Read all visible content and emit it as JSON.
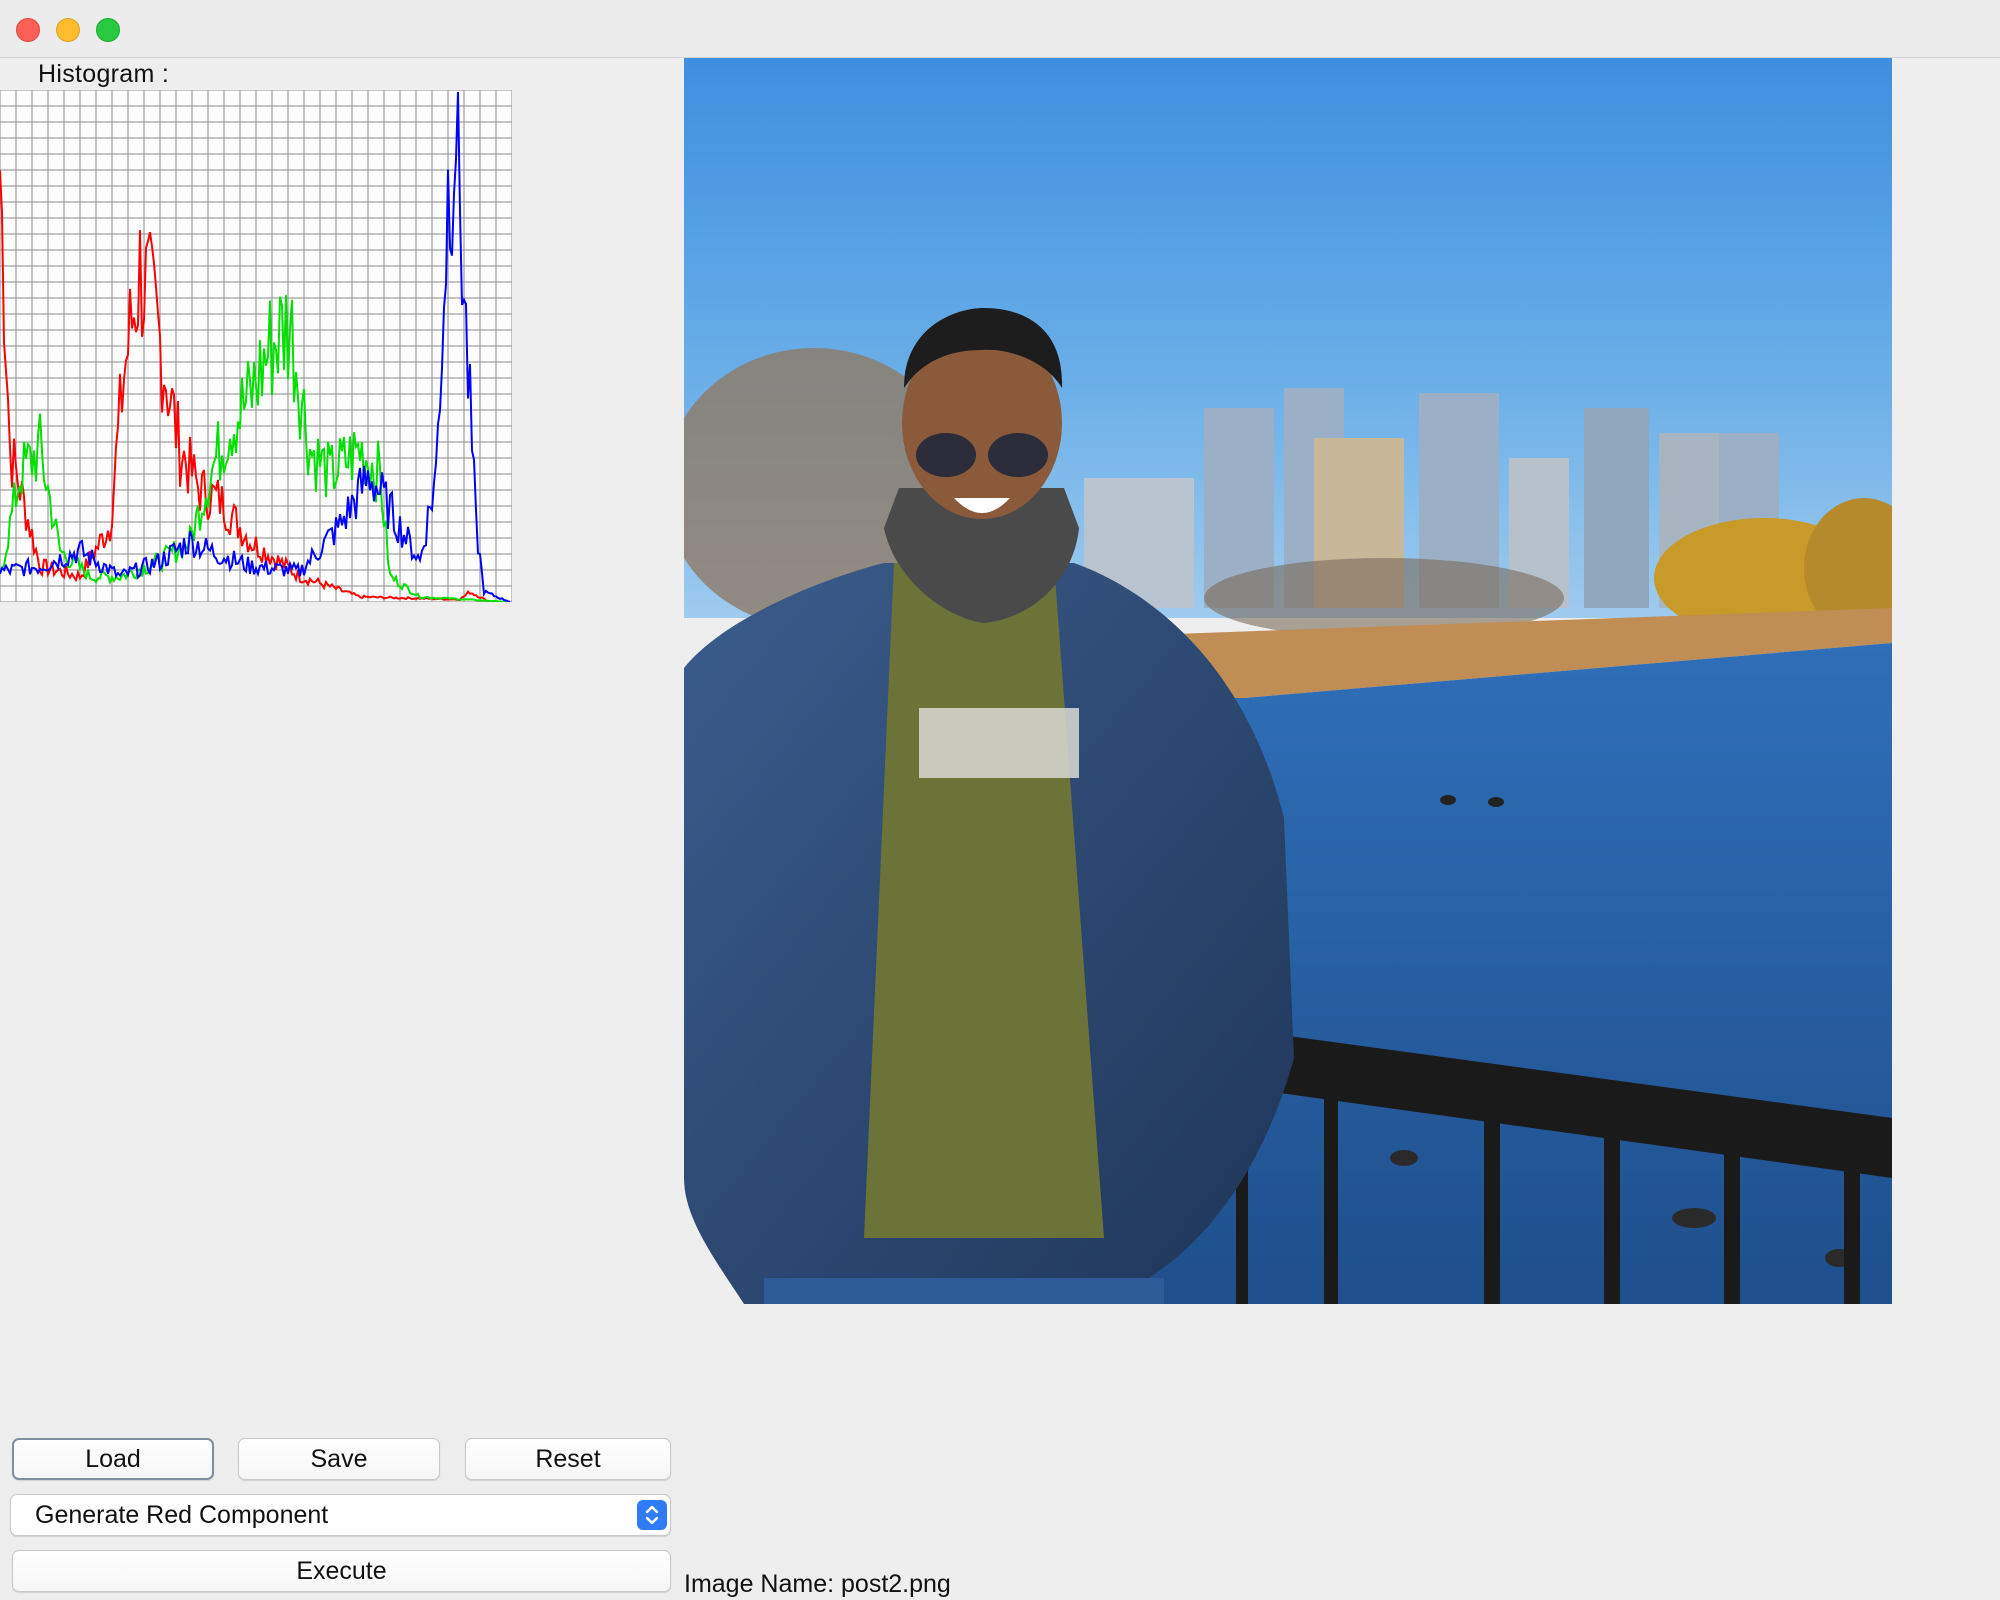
{
  "window": {
    "controls": [
      "close-button",
      "minimize-button",
      "maximize-button"
    ]
  },
  "histogram": {
    "label": "Histogram :"
  },
  "image": {
    "name_label": "Image Name: post2.png"
  },
  "buttons": {
    "load": "Load",
    "save": "Save",
    "reset": "Reset",
    "execute": "Execute"
  },
  "operation_select": {
    "selected": "Generate Red Component"
  }
}
